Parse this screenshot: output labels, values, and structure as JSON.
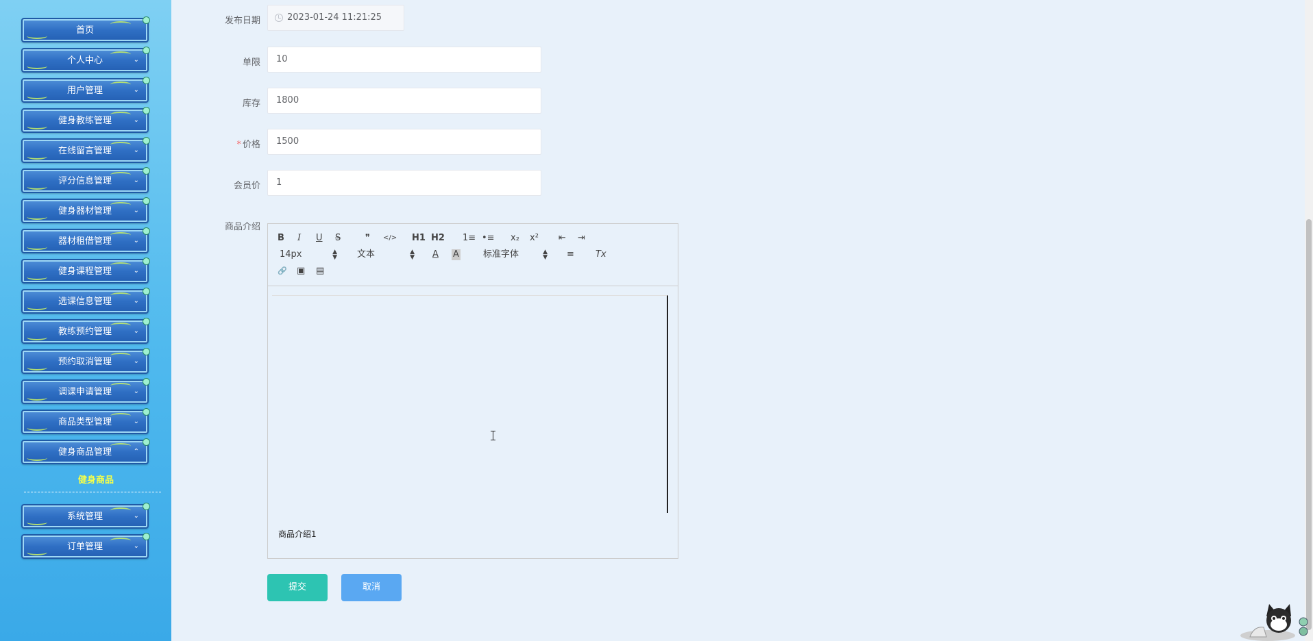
{
  "sidebar": {
    "items": [
      {
        "label": "首页",
        "chevron": ""
      },
      {
        "label": "个人中心",
        "chevron": "⌄"
      },
      {
        "label": "用户管理",
        "chevron": "⌄"
      },
      {
        "label": "健身教练管理",
        "chevron": "⌄"
      },
      {
        "label": "在线留言管理",
        "chevron": "⌄"
      },
      {
        "label": "评分信息管理",
        "chevron": "⌄"
      },
      {
        "label": "健身器材管理",
        "chevron": "⌄"
      },
      {
        "label": "器材租借管理",
        "chevron": "⌄"
      },
      {
        "label": "健身课程管理",
        "chevron": "⌄"
      },
      {
        "label": "选课信息管理",
        "chevron": "⌄"
      },
      {
        "label": "教练预约管理",
        "chevron": "⌄"
      },
      {
        "label": "预约取消管理",
        "chevron": "⌄"
      },
      {
        "label": "调课申请管理",
        "chevron": "⌄"
      },
      {
        "label": "商品类型管理",
        "chevron": "⌄"
      },
      {
        "label": "健身商品管理",
        "chevron": "⌃"
      },
      {
        "label": "系统管理",
        "chevron": "⌄"
      },
      {
        "label": "订单管理",
        "chevron": "⌄"
      }
    ],
    "active_sub_item": "健身商品"
  },
  "form": {
    "publish_date": {
      "label": "发布日期",
      "value": "2023-01-24 11:21:25"
    },
    "limit": {
      "label": "单限",
      "value": "10"
    },
    "stock": {
      "label": "库存",
      "value": "1800"
    },
    "price": {
      "label": "价格",
      "required_mark": "*",
      "value": "1500"
    },
    "member_price": {
      "label": "会员价",
      "value": "1"
    },
    "description": {
      "label": "商品介绍",
      "content": "商品介绍1"
    }
  },
  "editor_toolbar": {
    "bold": "B",
    "italic": "I",
    "underline": "U",
    "strike": "S",
    "blockquote": "❞",
    "code": "</>",
    "h1": "H1",
    "h2": "H2",
    "ordered_list": "1≡",
    "bullet_list": "•≡",
    "subscript": "x₂",
    "superscript": "x²",
    "outdent": "⇤",
    "indent": "⇥",
    "font_size": "14px",
    "header_select": "文本",
    "font_family": "标准字体",
    "color": "A",
    "background": "A",
    "align": "≡",
    "clean": "Tx",
    "link": "🔗",
    "image": "▣",
    "video": "▤"
  },
  "buttons": {
    "submit": "提交",
    "cancel": "取消"
  },
  "colors": {
    "sidebar_top": "#7fd0f3",
    "sidebar_bottom": "#3aa9e8",
    "menu_button": "#2f6fc4",
    "active_sub_item": "#f5ff4a",
    "submit_button": "#2dc4b2",
    "cancel_button": "#5aa8f2",
    "required": "#f56c6c",
    "page_background": "#e8f1fa"
  }
}
